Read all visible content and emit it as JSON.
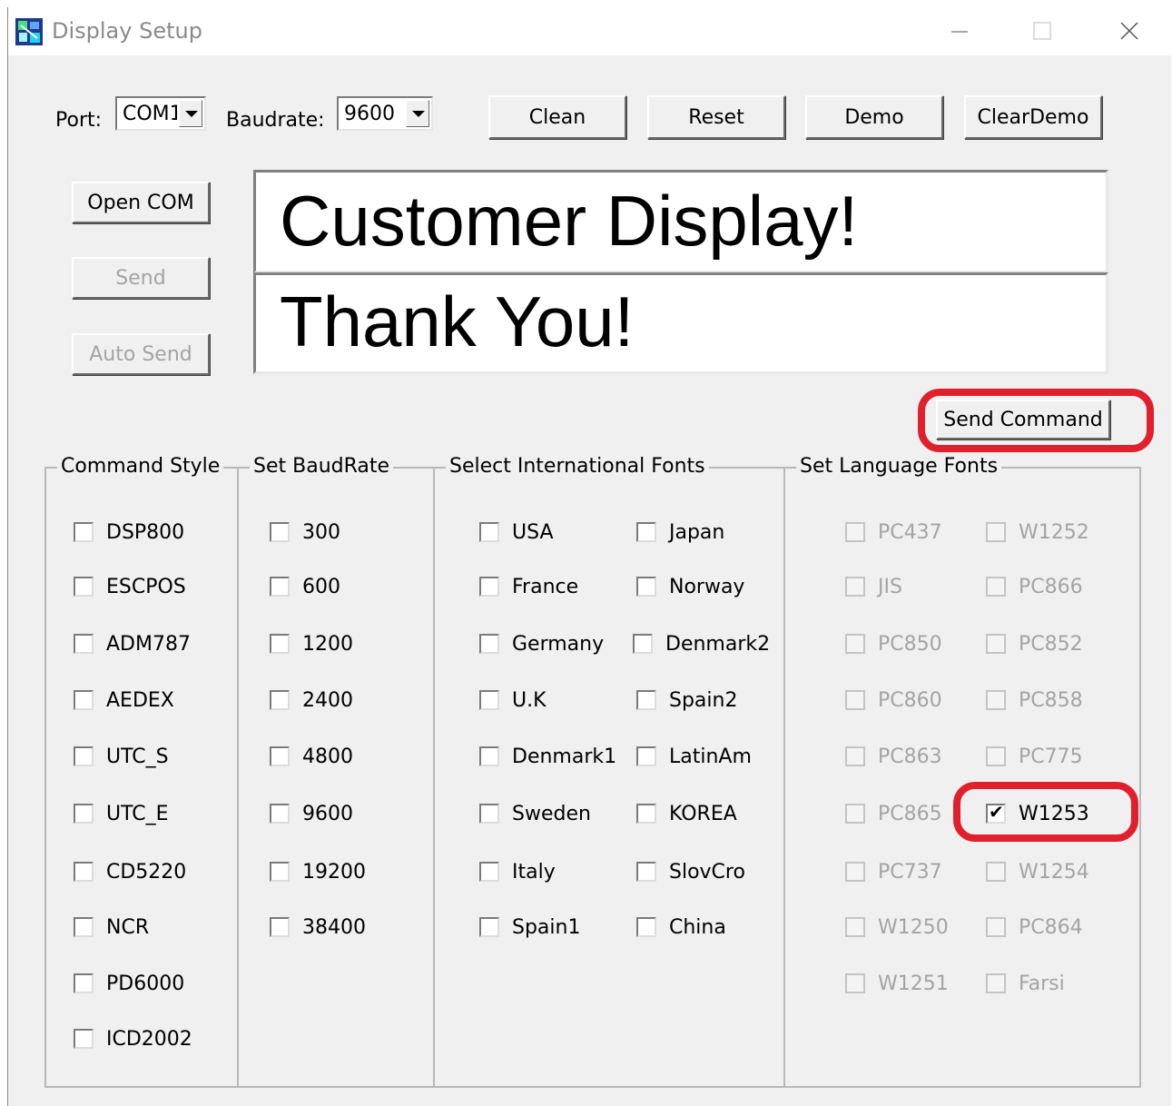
{
  "window": {
    "title": "Display Setup",
    "icon": "app-icon",
    "controls": [
      "minimize-icon",
      "maximize-icon",
      "close-icon"
    ]
  },
  "toolbar": {
    "port_label": "Port:",
    "port_value": "COM1",
    "baud_label": "Baudrate:",
    "baud_value": "9600",
    "clean_label": "Clean",
    "reset_label": "Reset",
    "demo_label": "Demo",
    "cleardemo_label": "ClearDemo"
  },
  "left_buttons": {
    "open_com": "Open COM",
    "send": "Send",
    "auto_send": "Auto Send"
  },
  "display": {
    "line1": "Customer Display!",
    "line2": "Thank You!"
  },
  "send_command_label": "Send Command",
  "highlight_color": "#e0212d",
  "groups": {
    "command_style": {
      "title": "Command Style",
      "items": [
        "DSP800",
        "ESCPOS",
        "ADM787",
        "AEDEX",
        "UTC_S",
        "UTC_E",
        "CD5220",
        "NCR",
        "PD6000",
        "ICD2002"
      ]
    },
    "set_baudrate": {
      "title": "Set BaudRate",
      "items": [
        "300",
        "600",
        "1200",
        "2400",
        "4800",
        "9600",
        "19200",
        "38400"
      ]
    },
    "intl_fonts": {
      "title": "Select International Fonts",
      "col1": [
        "USA",
        "France",
        "Germany",
        "U.K",
        "Denmark1",
        "Sweden",
        "Italy",
        "Spain1"
      ],
      "col2": [
        "Japan",
        "Norway",
        "Denmark2",
        "Spain2",
        "LatinAm",
        "KOREA",
        "SlovCro",
        "China"
      ]
    },
    "language_fonts": {
      "title": "Set Language Fonts",
      "col1": [
        "PC437",
        "JIS",
        "PC850",
        "PC860",
        "PC863",
        "PC865",
        "PC737",
        "W1250",
        "W1251"
      ],
      "col2": [
        "W1252",
        "PC866",
        "PC852",
        "PC858",
        "PC775",
        "W1253",
        "W1254",
        "PC864",
        "Farsi"
      ],
      "checked": "W1253"
    }
  }
}
